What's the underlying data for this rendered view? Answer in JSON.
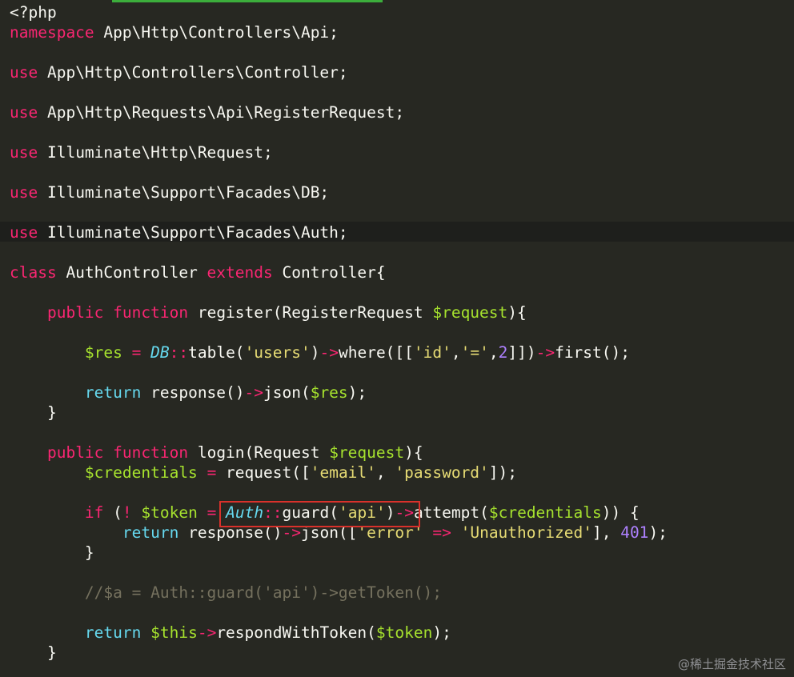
{
  "editor": {
    "colors": {
      "background": "#272822",
      "keyword": "#f92672",
      "variable": "#a6e22e",
      "string": "#e6db74",
      "number": "#ae81ff",
      "class": "#66d9ef",
      "comment": "#75715e",
      "annotation": "#d9312b",
      "tab_indicator": "#3cae3c"
    },
    "lines": [
      [
        [
          "pl",
          "<?php"
        ]
      ],
      [
        [
          "kw",
          "namespace"
        ],
        [
          "pl",
          " App\\Http\\Controllers\\Api;"
        ]
      ],
      [],
      [
        [
          "kw",
          "use"
        ],
        [
          "pl",
          " App\\Http\\Controllers\\Controller;"
        ]
      ],
      [],
      [
        [
          "kw",
          "use"
        ],
        [
          "pl",
          " App\\Http\\Requests\\Api\\RegisterRequest;"
        ]
      ],
      [],
      [
        [
          "kw",
          "use"
        ],
        [
          "pl",
          " Illuminate\\Http\\Request;"
        ]
      ],
      [],
      [
        [
          "kw",
          "use"
        ],
        [
          "pl",
          " Illuminate\\Support\\Facades\\DB;"
        ]
      ],
      [],
      [
        [
          "kw",
          "use"
        ],
        [
          "pl",
          " Illuminate\\Support\\Facades\\Auth;"
        ]
      ],
      [],
      [
        [
          "kw",
          "class"
        ],
        [
          "pl",
          " AuthController "
        ],
        [
          "kw",
          "extends"
        ],
        [
          "pl",
          " Controller{"
        ]
      ],
      [],
      [
        [
          "pl",
          "    "
        ],
        [
          "kw",
          "public"
        ],
        [
          "pl",
          " "
        ],
        [
          "kw",
          "function"
        ],
        [
          "pl",
          " register(RegisterRequest "
        ],
        [
          "var",
          "$request"
        ],
        [
          "pl",
          "){"
        ]
      ],
      [],
      [
        [
          "pl",
          "        "
        ],
        [
          "var",
          "$res"
        ],
        [
          "pl",
          " "
        ],
        [
          "op",
          "="
        ],
        [
          "pl",
          " "
        ],
        [
          "cls",
          "DB"
        ],
        [
          "op",
          "::"
        ],
        [
          "pl",
          "table("
        ],
        [
          "str",
          "'users'"
        ],
        [
          "pl",
          ")"
        ],
        [
          "op",
          "->"
        ],
        [
          "pl",
          "where([["
        ],
        [
          "str",
          "'id'"
        ],
        [
          "pl",
          ","
        ],
        [
          "str",
          "'='"
        ],
        [
          "pl",
          ","
        ],
        [
          "num",
          "2"
        ],
        [
          "pl",
          "]])"
        ],
        [
          "op",
          "->"
        ],
        [
          "pl",
          "first();"
        ]
      ],
      [],
      [
        [
          "pl",
          "        "
        ],
        [
          "ret",
          "return"
        ],
        [
          "pl",
          " response()"
        ],
        [
          "op",
          "->"
        ],
        [
          "pl",
          "json("
        ],
        [
          "var",
          "$res"
        ],
        [
          "pl",
          ");"
        ]
      ],
      [
        [
          "pl",
          "    }"
        ]
      ],
      [],
      [
        [
          "pl",
          "    "
        ],
        [
          "kw",
          "public"
        ],
        [
          "pl",
          " "
        ],
        [
          "kw",
          "function"
        ],
        [
          "pl",
          " login(Request "
        ],
        [
          "var",
          "$request"
        ],
        [
          "pl",
          "){"
        ]
      ],
      [
        [
          "pl",
          "        "
        ],
        [
          "var",
          "$credentials"
        ],
        [
          "pl",
          " "
        ],
        [
          "op",
          "="
        ],
        [
          "pl",
          " request(["
        ],
        [
          "str",
          "'email'"
        ],
        [
          "pl",
          ", "
        ],
        [
          "str",
          "'password'"
        ],
        [
          "pl",
          "]);"
        ]
      ],
      [],
      [
        [
          "pl",
          "        "
        ],
        [
          "kw",
          "if"
        ],
        [
          "pl",
          " ("
        ],
        [
          "op",
          "!"
        ],
        [
          "pl",
          " "
        ],
        [
          "var",
          "$token"
        ],
        [
          "pl",
          " "
        ],
        [
          "op",
          "="
        ],
        [
          "pl",
          " "
        ],
        [
          "cls",
          "Auth"
        ],
        [
          "op",
          "::"
        ],
        [
          "pl",
          "guard("
        ],
        [
          "str",
          "'api'"
        ],
        [
          "pl",
          ")"
        ],
        [
          "op",
          "->"
        ],
        [
          "pl",
          "attempt("
        ],
        [
          "var",
          "$credentials"
        ],
        [
          "pl",
          ")) {"
        ]
      ],
      [
        [
          "pl",
          "            "
        ],
        [
          "ret",
          "return"
        ],
        [
          "pl",
          " response()"
        ],
        [
          "op",
          "->"
        ],
        [
          "pl",
          "json(["
        ],
        [
          "str",
          "'error'"
        ],
        [
          "pl",
          " "
        ],
        [
          "op",
          "=>"
        ],
        [
          "pl",
          " "
        ],
        [
          "str",
          "'Unauthorized'"
        ],
        [
          "pl",
          "], "
        ],
        [
          "num",
          "401"
        ],
        [
          "pl",
          ");"
        ]
      ],
      [
        [
          "pl",
          "        }"
        ]
      ],
      [],
      [
        [
          "pl",
          "        "
        ],
        [
          "cm",
          "//$a = Auth::guard('api')->getToken();"
        ]
      ],
      [],
      [
        [
          "pl",
          "        "
        ],
        [
          "ret",
          "return"
        ],
        [
          "pl",
          " "
        ],
        [
          "var",
          "$this"
        ],
        [
          "op",
          "->"
        ],
        [
          "pl",
          "respondWithToken("
        ],
        [
          "var",
          "$token"
        ],
        [
          "pl",
          ");"
        ]
      ],
      [
        [
          "pl",
          "    }"
        ]
      ]
    ]
  },
  "watermark": "@稀土掘金技术社区"
}
